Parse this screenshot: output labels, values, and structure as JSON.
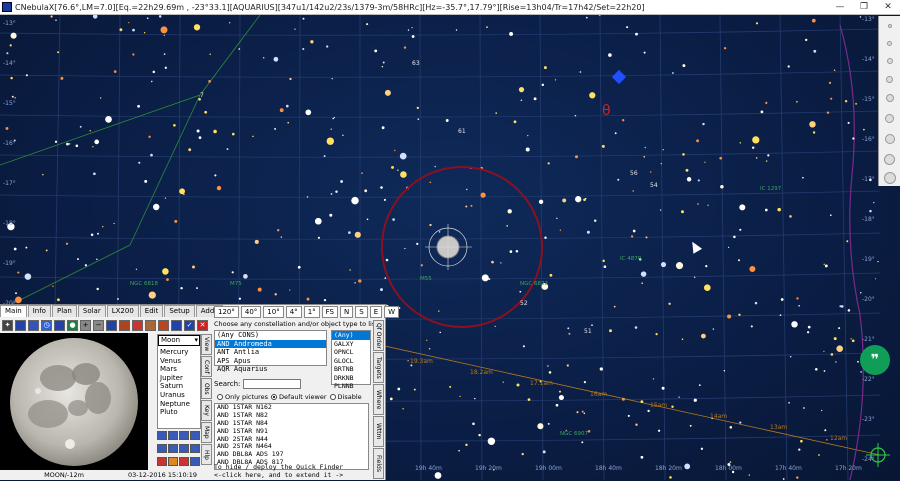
{
  "window": {
    "title": "CNebulaX[76.6°,LM=7.0][Eq.=22h29.69m , -23°33.1][AQUARIUS][347u1/142u2/23s/1379-3m/58HRc][Hz=-35.7°,17.79°][Rise=13h04/Tr=17h42/Set=22h20]",
    "minimize": "—",
    "maximize": "❐",
    "close": "✕"
  },
  "sky": {
    "dec_labels": [
      "-13°",
      "-14°",
      "-15°",
      "-16°",
      "-17°",
      "-18°",
      "-19°",
      "-20°",
      "-21°",
      "-22°",
      "-23°",
      "-24°",
      "-25°",
      "-26°",
      "-27°"
    ],
    "ra_labels": [
      "19h 40m",
      "19h 20m",
      "19h 00m",
      "18h 40m",
      "18h 20m",
      "18h 00m",
      "17h 40m",
      "17h 20m"
    ],
    "star_labels": [
      "61",
      "63",
      "56",
      "54",
      "7",
      "51",
      "52"
    ],
    "object_labels": [
      "NGC 6818",
      "M75",
      "NGC 6809",
      "M55",
      "NGC 6822",
      "IC 4870",
      "IC 1297",
      "NGC 6907"
    ],
    "ecliptic_labels": [
      "19.3am",
      "18.2am",
      "17.1am",
      "16am",
      "15am",
      "14am",
      "13am",
      "12am"
    ],
    "colors": {
      "fov_ring": "#8b1020",
      "ecliptic": "#b87a1e",
      "grid": "#233b6e",
      "milkyway_edge": "#7a2a8a"
    }
  },
  "panel": {
    "main_tabs": [
      "Main",
      "Info",
      "Plan",
      "Solar",
      "LX200",
      "Edit",
      "Setup",
      "Adds"
    ],
    "fov_buttons": [
      "120°",
      "40°",
      "10°",
      "4°",
      "1°",
      "FS",
      "N",
      "S",
      "E",
      "W"
    ],
    "planet_selected": "Moon",
    "planets": [
      "Mercury",
      "Venus",
      "Mars",
      "Jupiter",
      "Saturn",
      "Uranus",
      "Neptune",
      "Pluto"
    ],
    "side_tabs_left": [
      "View",
      "Conf",
      "Obs",
      "Key",
      "Map",
      "Hlp"
    ],
    "finder_prompt": "Choose any constellation and/or object type to list",
    "constellations": [
      "(Any CONS)",
      "AND Andromeda",
      "ANT Antlia",
      "APS Apus",
      "AQR Aquarius"
    ],
    "types": [
      "(Any)",
      "GALXY",
      "OPNCL",
      "GLOCL",
      "BRTNB",
      "DRKNB",
      "PLNNB"
    ],
    "search_label": "Search:",
    "radio_only_pictures": "Only pictures",
    "radio_default_viewer": "Default viewer",
    "radio_disable": "Disable",
    "results": [
      "AND 1STAR N162",
      "AND 1STAR N82",
      "AND 1STAR N84",
      "AND 1STAR N91",
      "AND 2STAR N44",
      "AND 2STAR N464",
      "AND DBL8A ADS 197",
      "AND DBL8A ADS 817"
    ],
    "hint_line1": "To hide / deploy the Quick Finder",
    "hint_line2": "<-click here, and to extend it ->",
    "side_tabs_right": [
      "Qf Order",
      "Targets",
      "Where",
      "Wttm",
      "Fields"
    ],
    "moon_caption": "MOON/-12m",
    "moon_date": "03-12-2016 15:10:19"
  }
}
